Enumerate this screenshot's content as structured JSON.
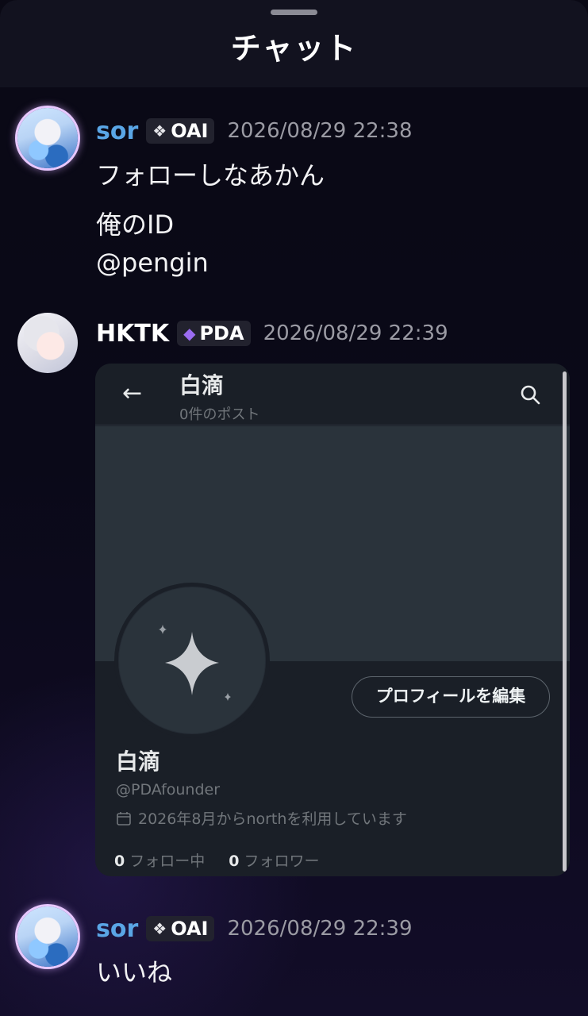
{
  "header": {
    "title": "チャット"
  },
  "messages": [
    {
      "author": "sor",
      "badge": {
        "icon": "sparkle-diamond-icon",
        "label": "OAI"
      },
      "time": "2026/08/29 22:38",
      "lines": [
        "フォローしなあかん",
        "俺のID",
        "@pengin"
      ]
    },
    {
      "author": "HKTK",
      "badge": {
        "icon": "amethyst-gem-icon",
        "label": "PDA"
      },
      "time": "2026/08/29 22:39",
      "attachment": {
        "title": "白滴",
        "subtitle": "0件のポスト",
        "edit_label": "プロフィールを編集",
        "name": "白滴",
        "handle": "@PDAfounder",
        "joined": "2026年8月からnorthを利用しています",
        "following_count": "0",
        "following_label": "フォロー中",
        "followers_count": "0",
        "followers_label": "フォロワー"
      }
    },
    {
      "author": "sor",
      "badge": {
        "icon": "sparkle-diamond-icon",
        "label": "OAI"
      },
      "time": "2026/08/29 22:39",
      "lines": [
        "いいね"
      ]
    }
  ],
  "colors": {
    "background": "#0a0915",
    "header": "#12121f",
    "name_sor": "#5aa6e6",
    "timestamp": "#9b9ba4",
    "badge_bg": "#22222e",
    "card_bg": "#1a1f27",
    "card_banner": "#2a333b"
  }
}
